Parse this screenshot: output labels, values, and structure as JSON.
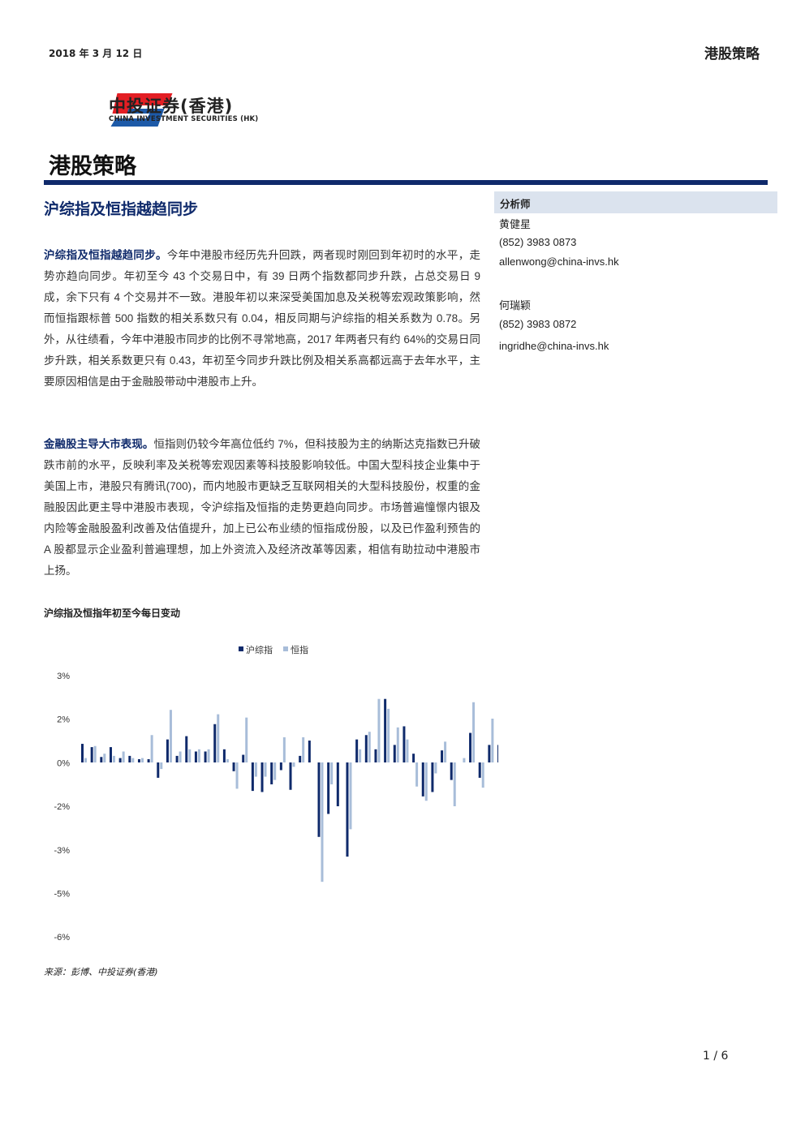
{
  "header": {
    "date": "2018 年 3 月 12 日",
    "report_type": "港股策略"
  },
  "logo": {
    "name_cn": "中投证券(香港)",
    "name_en": "CHINA INVESTMENT SECURITIES (HK)",
    "colors": {
      "red": "#e31e24",
      "blue": "#1d5aa8"
    }
  },
  "page_title": "港股策略",
  "article_title": "沪综指及恒指越趋同步",
  "paragraphs": [
    {
      "lead": "沪综指及恒指越趋同步。",
      "text": "今年中港股市经历先升回跌，两者现时刚回到年初时的水平，走势亦趋向同步。年初至今 43 个交易日中，有 39 日两个指数都同步升跌，占总交易日 9 成，余下只有 4 个交易并不一致。港股年初以来深受美国加息及关税等宏观政策影响，然而恒指跟标普 500 指数的相关系数只有 0.04，相反同期与沪综指的相关系数为 0.78。另外，从往绩看，今年中港股市同步的比例不寻常地高，2017 年两者只有约 64%的交易日同步升跌，相关系数更只有 0.43，年初至今同步升跌比例及相关系高都远高于去年水平，主要原因相信是由于金融股带动中港股市上升。"
    },
    {
      "lead": "金融股主导大市表现。",
      "text": "恒指则仍较今年高位低约 7%，但科技股为主的纳斯达克指数已升破跌市前的水平，反映利率及关税等宏观因素等科技股影响较低。中国大型科技企业集中于美国上市，港股只有腾讯(700)，而内地股市更缺乏互联网相关的大型科技股份，权重的金融股因此更主导中港股市表现，令沪综指及恒指的走势更趋向同步。市场普遍憧憬内银及内险等金融股盈利改善及估值提升，加上已公布业绩的恒指成份股，以及已作盈利预告的 A 股都显示企业盈利普遍理想，加上外资流入及经济改革等因素，相信有助拉动中港股市上扬。"
    }
  ],
  "sidebar": {
    "heading": "分析师",
    "analysts": [
      {
        "name": "黄健星",
        "phone": "(852) 3983 0873",
        "email": "allenwong@china-invs.hk"
      },
      {
        "name": "何瑞颖",
        "phone": "(852) 3983 0872",
        "email": "ingridhe@china-invs.hk"
      }
    ]
  },
  "chart_title": "沪综指及恒指年初至今每日变动",
  "chart_data": {
    "type": "bar",
    "legend_position": "top-center",
    "series": [
      {
        "name": "沪综指",
        "color": "#0f2a6b",
        "values": [
          0.85,
          0.7,
          0.25,
          0.7,
          0.2,
          0.3,
          0.15,
          0.15,
          -0.7,
          1.05,
          0.3,
          1.2,
          0.5,
          0.5,
          1.75,
          0.6,
          -0.4,
          0.35,
          -1.3,
          -1.35,
          -1.0,
          -0.35,
          -1.25,
          0.3,
          1.0,
          -3.4,
          -2.35,
          -2.0,
          -4.3,
          1.05,
          1.25,
          0.6,
          2.9,
          0.8,
          1.65,
          0.4,
          -1.55,
          -1.35,
          0.55,
          -0.8,
          0.0,
          1.35,
          -0.7,
          0.8,
          0.8
        ],
        "mismatch_color": "#e31e24",
        "mismatch_values": [
          -1.55,
          0.6,
          -0.2,
          -2.6
        ]
      },
      {
        "name": "恒指",
        "color": "#a8bdd9",
        "values": [
          0.2,
          0.75,
          0.4,
          0.3,
          0.5,
          0.2,
          0.2,
          1.25,
          -0.3,
          2.4,
          0.5,
          0.6,
          0.6,
          0.6,
          2.2,
          0.15,
          -1.2,
          2.05,
          -0.65,
          -0.65,
          -0.8,
          1.15,
          -0.2,
          1.15,
          0.0,
          -5.45,
          -1.0,
          0.0,
          -3.05,
          0.6,
          1.4,
          2.9,
          2.45,
          1.6,
          1.05,
          -1.1,
          -1.75,
          -0.5,
          0.95,
          -2.0,
          0.2,
          2.75,
          -1.15,
          2.0,
          1.35
        ]
      }
    ],
    "y_tick_labels": [
      "3%",
      "2%",
      "0%",
      "-2%",
      "-3%",
      "-5%",
      "-6%"
    ],
    "ylim": [
      -6,
      3
    ]
  },
  "source": "来源：彭博、中投证券(香港)",
  "page_number": "1 / 6"
}
